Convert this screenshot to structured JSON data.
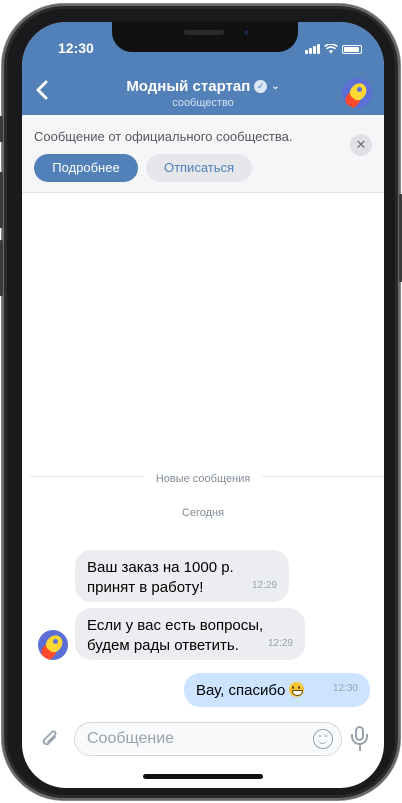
{
  "status_bar": {
    "time": "12:30"
  },
  "header": {
    "title": "Модный стартап",
    "subtitle": "сообщество",
    "back_icon": "chevron-left-icon",
    "verified_icon": "verified-check-icon"
  },
  "banner": {
    "text": "Сообщение от официального сообщества.",
    "primary_button": "Подробнее",
    "secondary_button": "Отписаться"
  },
  "chat": {
    "new_messages_label": "Новые сообщения",
    "date_label": "Сегодня",
    "messages": [
      {
        "direction": "incoming",
        "line1": "Ваш заказ на 1000 р.",
        "line2": "принят в работу!",
        "time": "12:29"
      },
      {
        "direction": "incoming",
        "line1": "Если у вас есть вопросы,",
        "line2": "будем рады ответить.",
        "time": "12:29"
      },
      {
        "direction": "outgoing",
        "text": "Вау, спасибо",
        "emoji": "grinning-face",
        "time": "12:30"
      }
    ]
  },
  "composer": {
    "placeholder": "Сообщение",
    "value": ""
  },
  "colors": {
    "accent": "#5181b8",
    "outgoing_bubble": "#cce4ff",
    "incoming_bubble": "#ebedf0"
  }
}
